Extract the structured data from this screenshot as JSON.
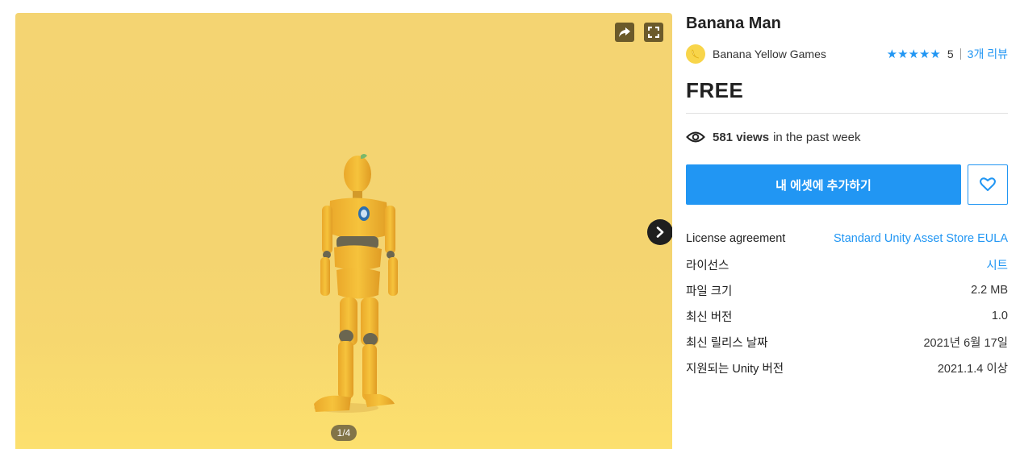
{
  "viewer": {
    "counter": "1/4"
  },
  "product": {
    "title": "Banana Man",
    "publisher": "Banana Yellow Games",
    "rating_stars": "★★★★★",
    "rating_value": "5",
    "reviews_label": "3개 리뷰",
    "price": "FREE",
    "views_count": "581 views",
    "views_suffix": "in the past week",
    "add_button_label": "내 에셋에 추가하기"
  },
  "details": [
    {
      "key": "License agreement",
      "value": "Standard Unity Asset Store EULA",
      "link": true
    },
    {
      "key": "라이선스",
      "value": "시트",
      "link": true
    },
    {
      "key": "파일 크기",
      "value": "2.2 MB",
      "link": false
    },
    {
      "key": "최신 버전",
      "value": "1.0",
      "link": false
    },
    {
      "key": "최신 릴리스 날짜",
      "value": "2021년 6월 17일",
      "link": false
    },
    {
      "key": "지원되는 Unity 버전",
      "value": "2021.1.4 이상",
      "link": false
    }
  ],
  "colors": {
    "accent": "#2196f3",
    "viewer_background": "#f4d472",
    "text": "#212121"
  },
  "icons": {
    "share": "share-icon",
    "fullscreen": "fullscreen-icon",
    "next": "chevron-right-icon",
    "eye": "eye-icon",
    "heart": "heart-icon",
    "publisher": "publisher-logo-icon"
  }
}
